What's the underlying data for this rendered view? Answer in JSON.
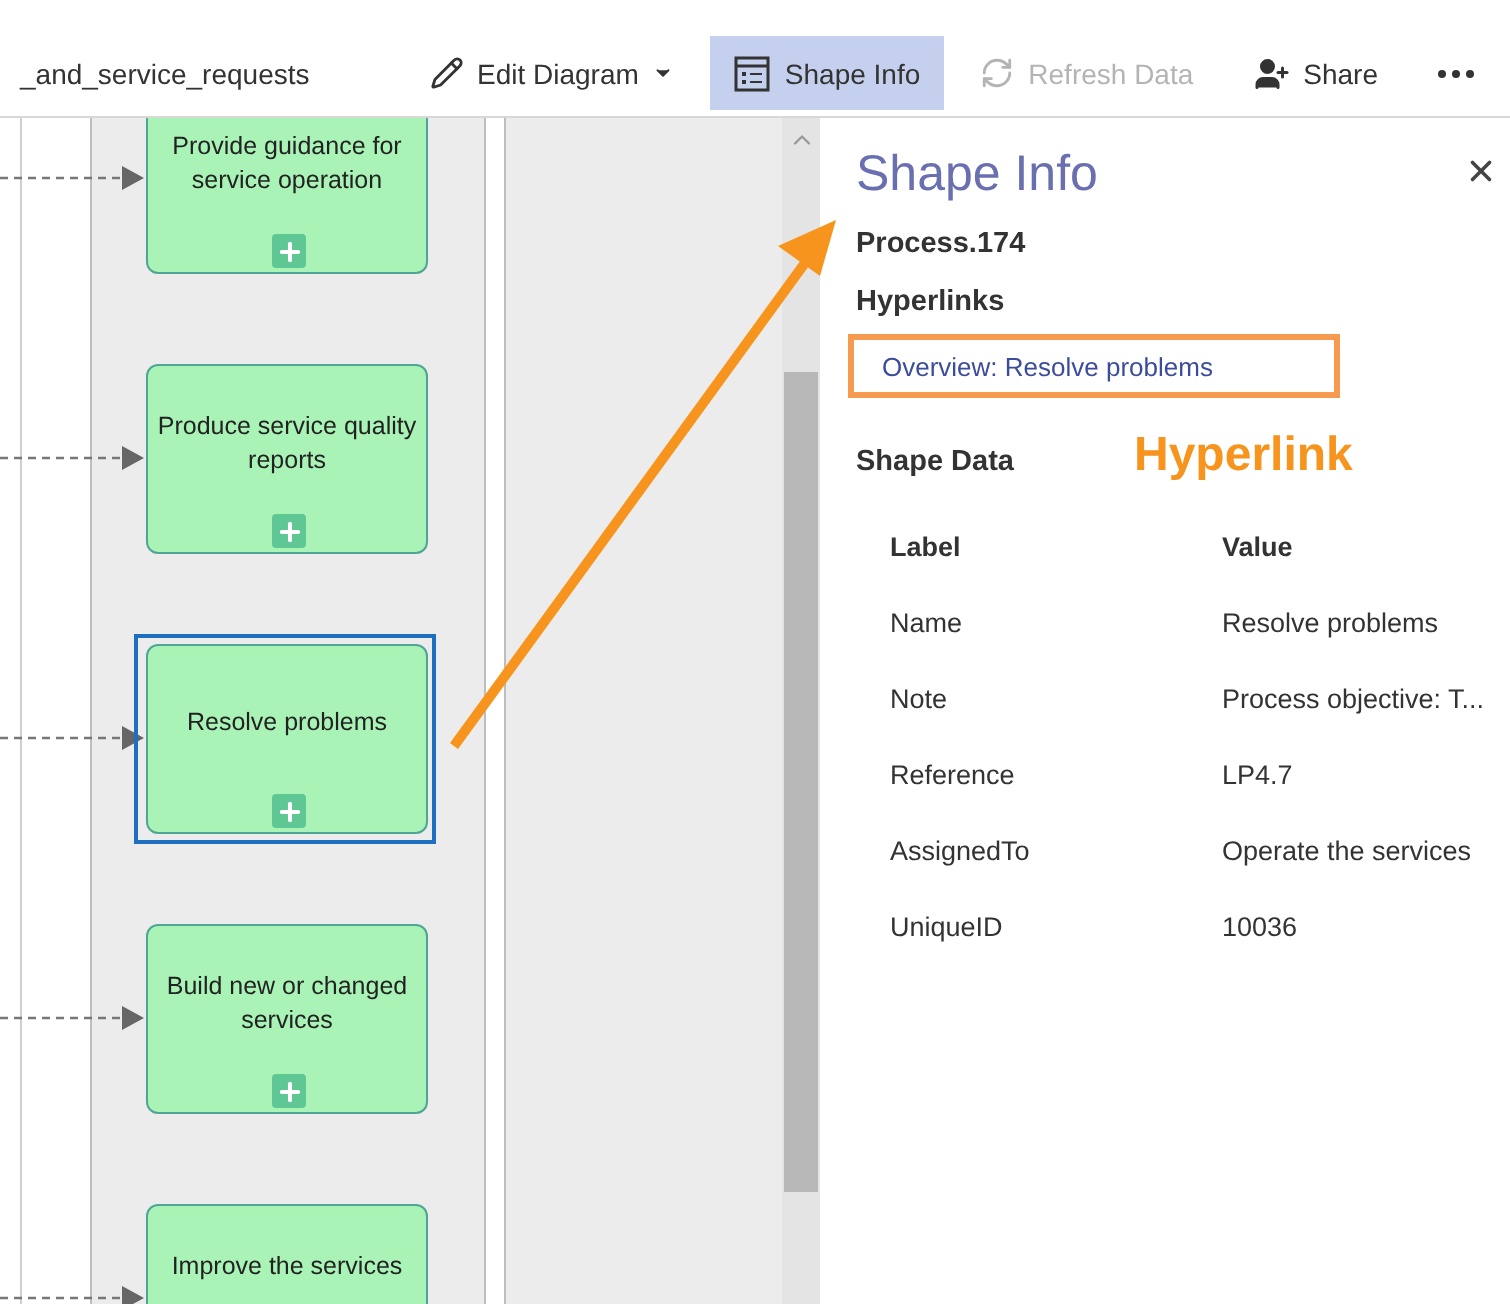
{
  "toolbar": {
    "file_name": "_and_service_requests",
    "buttons": [
      {
        "kind": "edit",
        "label": "Edit Diagram",
        "selected": false,
        "disabled": false,
        "has_menu": true
      },
      {
        "kind": "info",
        "label": "Shape Info",
        "selected": true,
        "disabled": false,
        "has_menu": false
      },
      {
        "kind": "refresh",
        "label": "Refresh Data",
        "selected": false,
        "disabled": true,
        "has_menu": false
      },
      {
        "kind": "share",
        "label": "Share",
        "selected": false,
        "disabled": false,
        "has_menu": false
      },
      {
        "kind": "more",
        "selected": false,
        "disabled": false,
        "has_menu": false
      }
    ]
  },
  "diagram": {
    "shapes": [
      {
        "label": "Provide guidance for service operation",
        "selected": false
      },
      {
        "label": "Produce service quality reports",
        "selected": false
      },
      {
        "label": "Resolve problems",
        "selected": true
      },
      {
        "label": "Build new or changed services",
        "selected": false
      },
      {
        "label": "Improve the services",
        "selected": false
      }
    ]
  },
  "annotation": {
    "label": "Hyperlink"
  },
  "panel": {
    "title": "Shape Info",
    "shape_name": "Process.174",
    "hyperlinks_heading": "Hyperlinks",
    "hyperlinks": [
      "Overview: Resolve problems"
    ],
    "shape_data_heading": "Shape Data",
    "columns": [
      "Label",
      "Value"
    ],
    "rows": [
      {
        "label": "Name",
        "value": "Resolve problems"
      },
      {
        "label": "Note",
        "value": "Process objective: T..."
      },
      {
        "label": "Reference",
        "value": "LP4.7"
      },
      {
        "label": "AssignedTo",
        "value": "Operate the services"
      },
      {
        "label": "UniqueID",
        "value": "10036"
      }
    ]
  }
}
